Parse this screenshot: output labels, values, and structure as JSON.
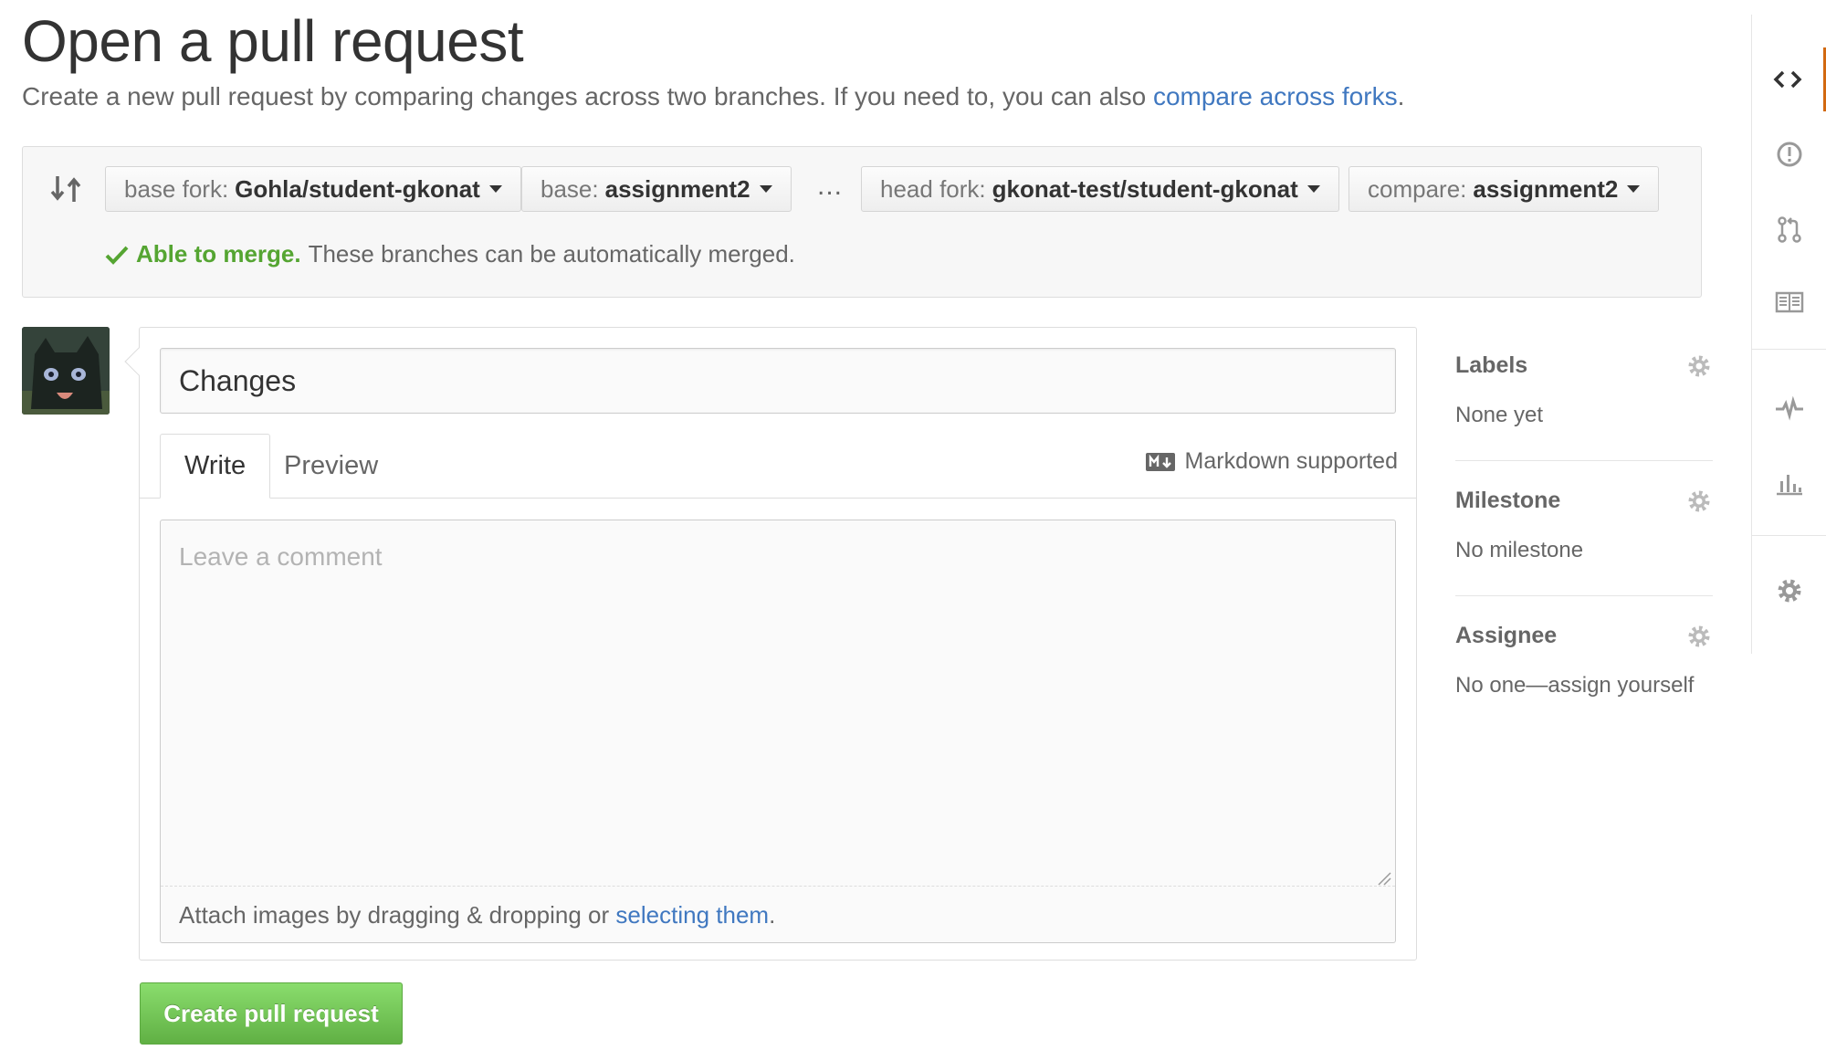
{
  "page": {
    "title": "Open a pull request",
    "subtitle": "Create a new pull request by comparing changes across two branches. If you need to, you can also",
    "subtitle_link": "compare across forks",
    "subtitle_end": "."
  },
  "compare": {
    "base_fork_label": "base fork:",
    "base_fork_value": "Gohla/student-gkonat",
    "base_label": "base:",
    "base_value": "assignment2",
    "separator": "...",
    "head_fork_label": "head fork:",
    "head_fork_value": "gkonat-test/student-gkonat",
    "compare_label": "compare:",
    "compare_value": "assignment2",
    "merge_ok": "Able to merge.",
    "merge_message": "These branches can be automatically merged."
  },
  "form": {
    "title_value": "Changes",
    "tab_write": "Write",
    "tab_preview": "Preview",
    "markdown_hint": "Markdown supported",
    "comment_placeholder": "Leave a comment",
    "attach_text": "Attach images by dragging & dropping or",
    "attach_link": "selecting them",
    "attach_end": ".",
    "submit_label": "Create pull request"
  },
  "sidebar": {
    "labels_heading": "Labels",
    "labels_value": "None yet",
    "milestone_heading": "Milestone",
    "milestone_value": "No milestone",
    "assignee_heading": "Assignee",
    "assignee_value": "No one—assign yourself"
  },
  "repo_nav": [
    "code-icon",
    "issues-icon",
    "pull-requests-icon",
    "wiki-icon",
    "pulse-icon",
    "graphs-icon",
    "settings-icon"
  ],
  "colors": {
    "link": "#4078c0",
    "success": "#55a532",
    "button_green": "#60b044",
    "nav_accent": "#d26911"
  }
}
